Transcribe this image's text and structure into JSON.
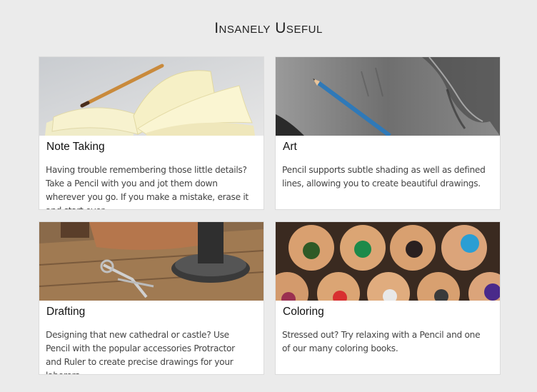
{
  "page": {
    "title": "Insanely Useful"
  },
  "cards": [
    {
      "image_icon": "notebook-pencil-photo",
      "heading": "Note Taking",
      "description": "Having trouble remembering those little details? Take a Pencil with you and jot them down wherever you go. If you make a mistake, erase it and start over."
    },
    {
      "image_icon": "pencil-sketch-photo",
      "heading": "Art",
      "description": "Pencil supports subtle shading as well as defined lines, allowing you to create beautiful drawings."
    },
    {
      "image_icon": "drafting-tools-photo",
      "heading": "Drafting",
      "description": "Designing that new cathedral or castle? Use Pencil with the popular accessories Protractor and Ruler to create precise drawings for your laborers."
    },
    {
      "image_icon": "colored-pencils-photo",
      "heading": "Coloring",
      "description": "Stressed out? Try relaxing with a Pencil and one of our many coloring books."
    }
  ]
}
